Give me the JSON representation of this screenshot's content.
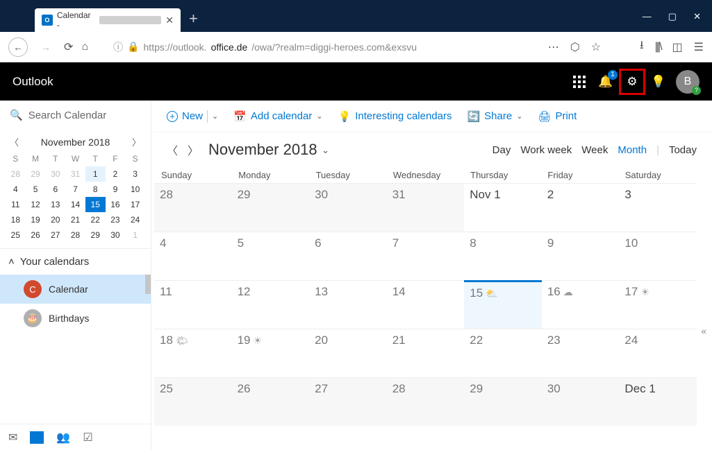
{
  "browser": {
    "tab_title": "Calendar -",
    "url_prefix": "https://outlook.",
    "url_host": "office.de",
    "url_path": "/owa/?realm=diggi-heroes.com&exsvu"
  },
  "header": {
    "app_name": "Outlook",
    "notification_count": "1",
    "avatar_initial": "B"
  },
  "sidebar": {
    "search_placeholder": "Search Calendar",
    "mini_month": "November 2018",
    "dow": [
      "S",
      "M",
      "T",
      "W",
      "T",
      "F",
      "S"
    ],
    "weeks": [
      [
        "28",
        "29",
        "30",
        "31",
        "1",
        "2",
        "3"
      ],
      [
        "4",
        "5",
        "6",
        "7",
        "8",
        "9",
        "10"
      ],
      [
        "11",
        "12",
        "13",
        "14",
        "15",
        "16",
        "17"
      ],
      [
        "18",
        "19",
        "20",
        "21",
        "22",
        "23",
        "24"
      ],
      [
        "25",
        "26",
        "27",
        "28",
        "29",
        "30",
        "1"
      ]
    ],
    "your_calendars_label": "Your calendars",
    "calendars": [
      {
        "label": "Calendar",
        "initial": "C",
        "color": "#d1492e",
        "active": true
      },
      {
        "label": "Birthdays",
        "initial": "🎂",
        "color": "#b0b0b0",
        "active": false
      }
    ]
  },
  "commands": {
    "new": "New",
    "add_calendar": "Add calendar",
    "interesting": "Interesting calendars",
    "share": "Share",
    "print": "Print"
  },
  "view": {
    "month_title": "November 2018",
    "options": {
      "day": "Day",
      "work_week": "Work week",
      "week": "Week",
      "month": "Month",
      "today": "Today"
    },
    "active": "Month",
    "dow": [
      "Sunday",
      "Monday",
      "Tuesday",
      "Wednesday",
      "Thursday",
      "Friday",
      "Saturday"
    ]
  },
  "grid": [
    [
      {
        "l": "28",
        "o": true
      },
      {
        "l": "29",
        "o": true
      },
      {
        "l": "30",
        "o": true
      },
      {
        "l": "31",
        "o": true
      },
      {
        "l": "Nov 1",
        "d": true
      },
      {
        "l": "2",
        "d": true
      },
      {
        "l": "3",
        "d": true
      }
    ],
    [
      {
        "l": "4"
      },
      {
        "l": "5"
      },
      {
        "l": "6"
      },
      {
        "l": "7"
      },
      {
        "l": "8"
      },
      {
        "l": "9"
      },
      {
        "l": "10"
      }
    ],
    [
      {
        "l": "11"
      },
      {
        "l": "12"
      },
      {
        "l": "13"
      },
      {
        "l": "14"
      },
      {
        "l": "15",
        "t": true,
        "w": "⛅"
      },
      {
        "l": "16",
        "w": "☁"
      },
      {
        "l": "17",
        "w": "☀"
      }
    ],
    [
      {
        "l": "18",
        "w": "🌤"
      },
      {
        "l": "19",
        "w": "☀"
      },
      {
        "l": "20"
      },
      {
        "l": "21"
      },
      {
        "l": "22"
      },
      {
        "l": "23"
      },
      {
        "l": "24"
      }
    ],
    [
      {
        "l": "25",
        "o": true
      },
      {
        "l": "26",
        "o": true
      },
      {
        "l": "27",
        "o": true
      },
      {
        "l": "28",
        "o": true
      },
      {
        "l": "29",
        "o": true
      },
      {
        "l": "30",
        "o": true
      },
      {
        "l": "Dec 1",
        "o": true,
        "d": true
      }
    ]
  ]
}
